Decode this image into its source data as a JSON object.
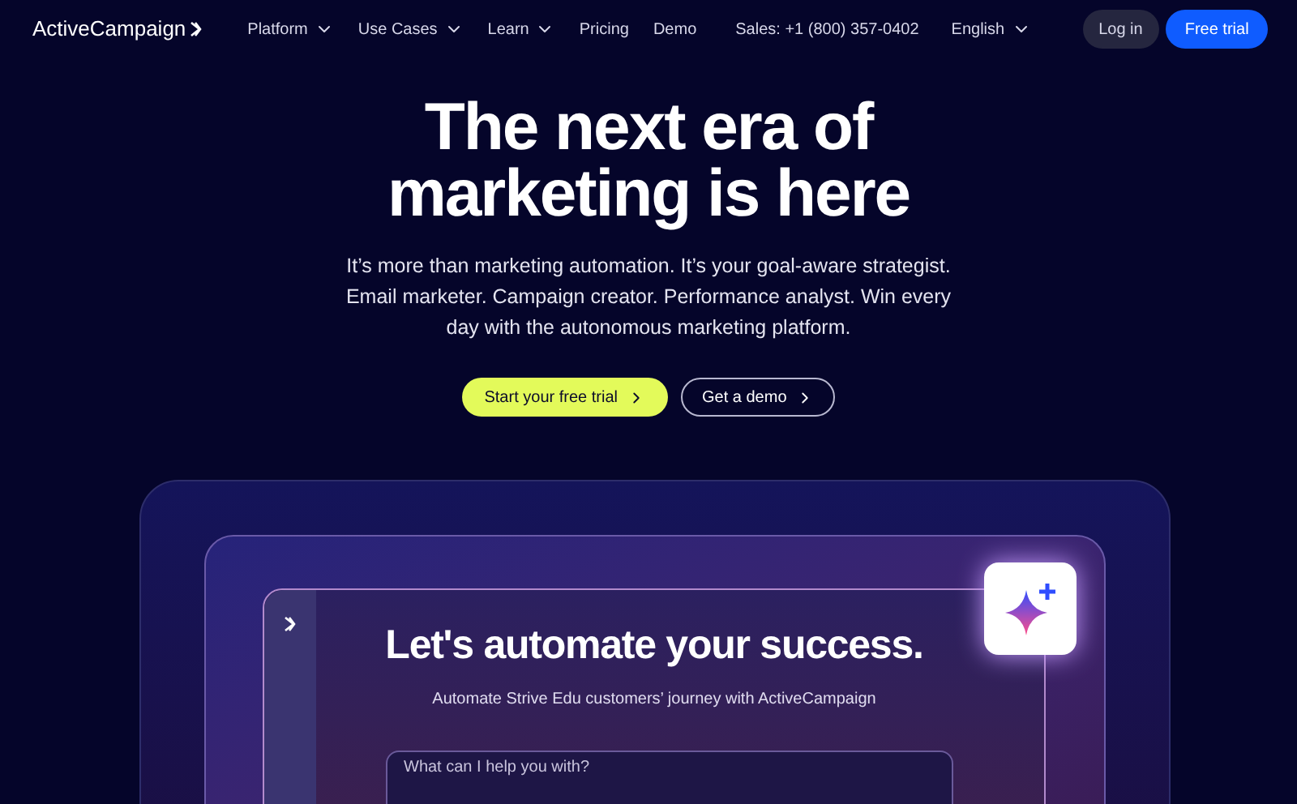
{
  "header": {
    "logo": "ActiveCampaign",
    "nav": [
      {
        "label": "Platform",
        "has_menu": true
      },
      {
        "label": "Use Cases",
        "has_menu": true
      },
      {
        "label": "Learn",
        "has_menu": true
      },
      {
        "label": "Pricing",
        "has_menu": false
      },
      {
        "label": "Demo",
        "has_menu": false
      }
    ],
    "sales": "Sales: +1 (800) 357-0402",
    "language": "English",
    "login": "Log in",
    "trial": "Free trial"
  },
  "hero": {
    "title_lines": [
      "The next era of",
      "marketing is here"
    ],
    "subtitle": "It’s more than marketing automation. It’s your goal-aware strategist. Email marketer. Campaign creator. Performance analyst. Win every day with the autonomous marketing platform.",
    "primary": "Start your free trial",
    "secondary": "Get a demo"
  },
  "preview": {
    "heading": "Let's automate your success.",
    "subheading": "Automate Strive Edu customers’ journey with ActiveCampaign",
    "input": {
      "placeholder": "What can I help you with?"
    }
  }
}
